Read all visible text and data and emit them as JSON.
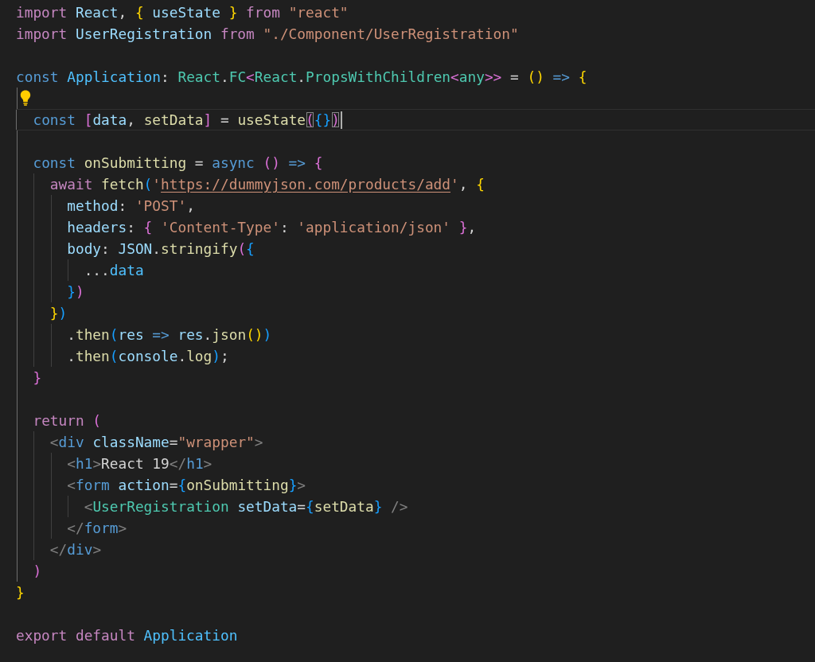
{
  "editor": {
    "lines": [
      {
        "current": false,
        "lightbulb": false,
        "tokens": [
          {
            "kind": "kw",
            "text": "import "
          },
          {
            "kind": "var",
            "text": "React"
          },
          {
            "kind": "p",
            "text": ", "
          },
          {
            "kind": "b1",
            "text": "{ "
          },
          {
            "kind": "var",
            "text": "useState "
          },
          {
            "kind": "b1",
            "text": "} "
          },
          {
            "kind": "kw",
            "text": "from "
          },
          {
            "kind": "str",
            "text": "\"react\""
          }
        ]
      },
      {
        "current": false,
        "lightbulb": false,
        "tokens": [
          {
            "kind": "kw",
            "text": "import "
          },
          {
            "kind": "var",
            "text": "UserRegistration "
          },
          {
            "kind": "kw",
            "text": "from "
          },
          {
            "kind": "str",
            "text": "\"./Component/UserRegistration\""
          }
        ]
      },
      {
        "current": false,
        "lightbulb": false
      },
      {
        "current": false,
        "lightbulb": false,
        "tokens": [
          {
            "kind": "storage",
            "text": "const "
          },
          {
            "kind": "const",
            "text": "Application"
          },
          {
            "kind": "p",
            "text": ": "
          },
          {
            "kind": "type",
            "text": "React"
          },
          {
            "kind": "p",
            "text": "."
          },
          {
            "kind": "type",
            "text": "FC"
          },
          {
            "kind": "b2",
            "text": "<"
          },
          {
            "kind": "type",
            "text": "React"
          },
          {
            "kind": "p",
            "text": "."
          },
          {
            "kind": "type",
            "text": "PropsWithChildren"
          },
          {
            "kind": "b2",
            "text": "<"
          },
          {
            "kind": "type",
            "text": "any"
          },
          {
            "kind": "b2",
            "text": ">> "
          },
          {
            "kind": "p",
            "text": "= "
          },
          {
            "kind": "b1",
            "text": "() "
          },
          {
            "kind": "storage",
            "text": "=> "
          },
          {
            "kind": "b1",
            "text": "{"
          }
        ]
      },
      {
        "current": false,
        "lightbulb": true
      },
      {
        "current": true,
        "lightbulb": false,
        "tokens": [
          {
            "kind": "storage",
            "text": "  const "
          },
          {
            "kind": "b2",
            "text": "["
          },
          {
            "kind": "var",
            "text": "data"
          },
          {
            "kind": "p",
            "text": ", "
          },
          {
            "kind": "fn",
            "text": "setData"
          },
          {
            "kind": "b2",
            "text": "] "
          },
          {
            "kind": "p",
            "text": "= "
          },
          {
            "kind": "fn",
            "text": "useState"
          },
          {
            "kind": "match",
            "text": "("
          },
          {
            "kind": "b3",
            "text": "{}"
          },
          {
            "kind": "match",
            "text": ")"
          }
        ]
      },
      {
        "current": false,
        "lightbulb": false
      },
      {
        "current": false,
        "lightbulb": false,
        "tokens": [
          {
            "kind": "storage",
            "text": "  const "
          },
          {
            "kind": "fn",
            "text": "onSubmitting "
          },
          {
            "kind": "p",
            "text": "= "
          },
          {
            "kind": "storage",
            "text": "async "
          },
          {
            "kind": "b2",
            "text": "() "
          },
          {
            "kind": "storage",
            "text": "=> "
          },
          {
            "kind": "b2",
            "text": "{"
          }
        ]
      },
      {
        "current": false,
        "lightbulb": false,
        "tokens": [
          {
            "kind": "kw",
            "text": "    await "
          },
          {
            "kind": "fn",
            "text": "fetch"
          },
          {
            "kind": "b3",
            "text": "("
          },
          {
            "kind": "str",
            "text": "'"
          },
          {
            "kind": "link",
            "text": "https://dummyjson.com/products/add"
          },
          {
            "kind": "str",
            "text": "'"
          },
          {
            "kind": "p",
            "text": ", "
          },
          {
            "kind": "b1",
            "text": "{"
          }
        ]
      },
      {
        "current": false,
        "lightbulb": false,
        "tokens": [
          {
            "kind": "var",
            "text": "      method"
          },
          {
            "kind": "p",
            "text": ": "
          },
          {
            "kind": "str",
            "text": "'POST'"
          },
          {
            "kind": "p",
            "text": ","
          }
        ]
      },
      {
        "current": false,
        "lightbulb": false,
        "tokens": [
          {
            "kind": "var",
            "text": "      headers"
          },
          {
            "kind": "p",
            "text": ": "
          },
          {
            "kind": "b2",
            "text": "{ "
          },
          {
            "kind": "str",
            "text": "'Content-Type'"
          },
          {
            "kind": "p",
            "text": ": "
          },
          {
            "kind": "str",
            "text": "'application/json' "
          },
          {
            "kind": "b2",
            "text": "}"
          },
          {
            "kind": "p",
            "text": ","
          }
        ]
      },
      {
        "current": false,
        "lightbulb": false,
        "tokens": [
          {
            "kind": "var",
            "text": "      body"
          },
          {
            "kind": "p",
            "text": ": "
          },
          {
            "kind": "var",
            "text": "JSON"
          },
          {
            "kind": "p",
            "text": "."
          },
          {
            "kind": "fn",
            "text": "stringify"
          },
          {
            "kind": "b2",
            "text": "("
          },
          {
            "kind": "b3",
            "text": "{"
          }
        ]
      },
      {
        "current": false,
        "lightbulb": false,
        "tokens": [
          {
            "kind": "p",
            "text": "        ..."
          },
          {
            "kind": "const",
            "text": "data"
          }
        ]
      },
      {
        "current": false,
        "lightbulb": false,
        "tokens": [
          {
            "kind": "b3",
            "text": "      }"
          },
          {
            "kind": "b2",
            "text": ")"
          }
        ]
      },
      {
        "current": false,
        "lightbulb": false,
        "tokens": [
          {
            "kind": "b1",
            "text": "    }"
          },
          {
            "kind": "b3",
            "text": ")"
          }
        ]
      },
      {
        "current": false,
        "lightbulb": false,
        "tokens": [
          {
            "kind": "p",
            "text": "      ."
          },
          {
            "kind": "fn",
            "text": "then"
          },
          {
            "kind": "b3",
            "text": "("
          },
          {
            "kind": "var",
            "text": "res "
          },
          {
            "kind": "storage",
            "text": "=> "
          },
          {
            "kind": "var",
            "text": "res"
          },
          {
            "kind": "p",
            "text": "."
          },
          {
            "kind": "fn",
            "text": "json"
          },
          {
            "kind": "b1",
            "text": "()"
          },
          {
            "kind": "b3",
            "text": ")"
          }
        ]
      },
      {
        "current": false,
        "lightbulb": false,
        "tokens": [
          {
            "kind": "p",
            "text": "      ."
          },
          {
            "kind": "fn",
            "text": "then"
          },
          {
            "kind": "b3",
            "text": "("
          },
          {
            "kind": "var",
            "text": "console"
          },
          {
            "kind": "p",
            "text": "."
          },
          {
            "kind": "fn",
            "text": "log"
          },
          {
            "kind": "b3",
            "text": ")"
          },
          {
            "kind": "p",
            "text": ";"
          }
        ]
      },
      {
        "current": false,
        "lightbulb": false,
        "tokens": [
          {
            "kind": "b2",
            "text": "  }"
          }
        ]
      },
      {
        "current": false,
        "lightbulb": false
      },
      {
        "current": false,
        "lightbulb": false,
        "tokens": [
          {
            "kind": "kw",
            "text": "  return "
          },
          {
            "kind": "b2",
            "text": "("
          }
        ]
      },
      {
        "current": false,
        "lightbulb": false,
        "tokens": [
          {
            "kind": "tagp",
            "text": "    <"
          },
          {
            "kind": "tag",
            "text": "div "
          },
          {
            "kind": "var",
            "text": "className"
          },
          {
            "kind": "p",
            "text": "="
          },
          {
            "kind": "str",
            "text": "\"wrapper\""
          },
          {
            "kind": "tagp",
            "text": ">"
          }
        ]
      },
      {
        "current": false,
        "lightbulb": false,
        "tokens": [
          {
            "kind": "tagp",
            "text": "      <"
          },
          {
            "kind": "tag",
            "text": "h1"
          },
          {
            "kind": "tagp",
            "text": ">"
          },
          {
            "kind": "p",
            "text": "React 19"
          },
          {
            "kind": "tagp",
            "text": "</"
          },
          {
            "kind": "tag",
            "text": "h1"
          },
          {
            "kind": "tagp",
            "text": ">"
          }
        ]
      },
      {
        "current": false,
        "lightbulb": false,
        "tokens": [
          {
            "kind": "tagp",
            "text": "      <"
          },
          {
            "kind": "tag",
            "text": "form "
          },
          {
            "kind": "var",
            "text": "action"
          },
          {
            "kind": "p",
            "text": "="
          },
          {
            "kind": "b3",
            "text": "{"
          },
          {
            "kind": "fn",
            "text": "onSubmitting"
          },
          {
            "kind": "b3",
            "text": "}"
          },
          {
            "kind": "tagp",
            "text": ">"
          }
        ]
      },
      {
        "current": false,
        "lightbulb": false,
        "tokens": [
          {
            "kind": "tagp",
            "text": "        <"
          },
          {
            "kind": "type",
            "text": "UserRegistration "
          },
          {
            "kind": "var",
            "text": "setData"
          },
          {
            "kind": "p",
            "text": "="
          },
          {
            "kind": "b3",
            "text": "{"
          },
          {
            "kind": "fn",
            "text": "setData"
          },
          {
            "kind": "b3",
            "text": "} "
          },
          {
            "kind": "tagp",
            "text": "/>"
          }
        ]
      },
      {
        "current": false,
        "lightbulb": false,
        "tokens": [
          {
            "kind": "tagp",
            "text": "      </"
          },
          {
            "kind": "tag",
            "text": "form"
          },
          {
            "kind": "tagp",
            "text": ">"
          }
        ]
      },
      {
        "current": false,
        "lightbulb": false,
        "tokens": [
          {
            "kind": "tagp",
            "text": "    </"
          },
          {
            "kind": "tag",
            "text": "div"
          },
          {
            "kind": "tagp",
            "text": ">"
          }
        ]
      },
      {
        "current": false,
        "lightbulb": false,
        "tokens": [
          {
            "kind": "b2",
            "text": "  )"
          }
        ]
      },
      {
        "current": false,
        "lightbulb": false,
        "tokens": [
          {
            "kind": "b1",
            "text": "}"
          }
        ]
      },
      {
        "current": false,
        "lightbulb": false
      },
      {
        "current": false,
        "lightbulb": false,
        "tokens": [
          {
            "kind": "kw",
            "text": "export "
          },
          {
            "kind": "kw",
            "text": "default "
          },
          {
            "kind": "const",
            "text": "Application"
          }
        ]
      }
    ]
  }
}
